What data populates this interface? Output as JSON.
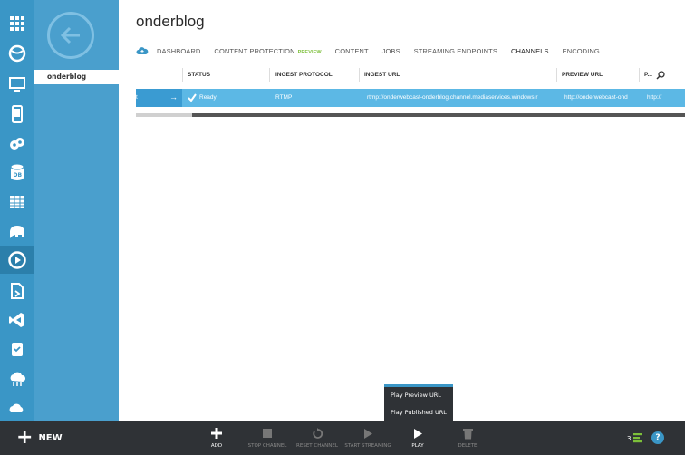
{
  "service_name": "onderblog",
  "page_title": "onderblog",
  "tabs": [
    {
      "label": "DASHBOARD"
    },
    {
      "label": "CONTENT PROTECTION",
      "badge": "PREVIEW"
    },
    {
      "label": "CONTENT"
    },
    {
      "label": "JOBS"
    },
    {
      "label": "STREAMING ENDPOINTS"
    },
    {
      "label": "CHANNELS",
      "active": true
    },
    {
      "label": "ENCODING"
    }
  ],
  "grid": {
    "columns": [
      "STATUS",
      "INGEST PROTOCOL",
      "INGEST URL",
      "PREVIEW URL",
      "P..."
    ],
    "row": {
      "name_fragment": "t",
      "arrow": "→",
      "status": "Ready",
      "protocol": "RTMP",
      "ingest_url": "rtmp://onderwebcast-onderblog.channel.mediaservices.windows.r",
      "preview_url": "http://onderwebcast-ond",
      "published_url": "http://"
    }
  },
  "commands": [
    {
      "label": "ADD",
      "icon": "plus-icon",
      "enabled": true
    },
    {
      "label": "STOP CHANNEL",
      "icon": "stop-icon",
      "enabled": false
    },
    {
      "label": "RESET CHANNEL",
      "icon": "reset-icon",
      "enabled": false
    },
    {
      "label": "START STREAMING",
      "icon": "play-icon",
      "enabled": false
    },
    {
      "label": "PLAY",
      "icon": "play-icon",
      "enabled": true
    },
    {
      "label": "DELETE",
      "icon": "trash-icon",
      "enabled": false
    }
  ],
  "new_label": "NEW",
  "play_menu": [
    "Play Preview URL",
    "Play Published URL"
  ],
  "notification_count": "3",
  "help_label": "?",
  "colors": {
    "rail": "#3a96c6",
    "subnav": "#4a9fcd",
    "selected_row": "#5cb8e5",
    "cmdbar": "#2f3236",
    "preview_badge": "#7cbf3a"
  }
}
